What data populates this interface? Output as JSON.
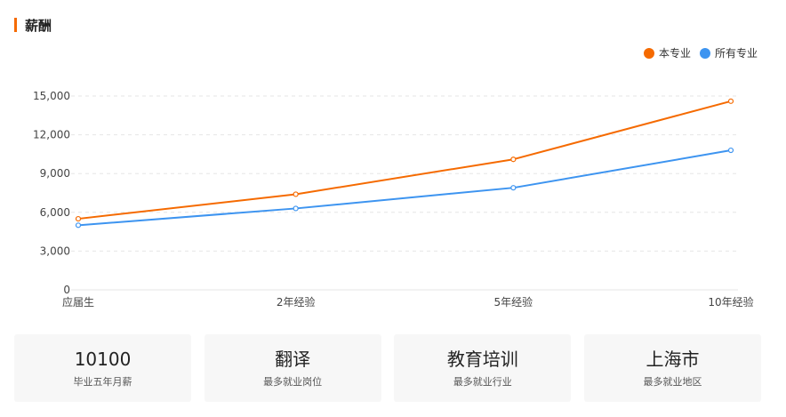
{
  "section": {
    "title": "薪酬",
    "accent_color": "#f56a00"
  },
  "chart_data": {
    "type": "line",
    "categories": [
      "应届生",
      "2年经验",
      "5年经验",
      "10年经验"
    ],
    "series": [
      {
        "name": "本专业",
        "color": "#f56a00",
        "values": [
          5500,
          7400,
          10100,
          14600
        ]
      },
      {
        "name": "所有专业",
        "color": "#3d94f0",
        "values": [
          5000,
          6300,
          7900,
          10800
        ]
      }
    ],
    "ylim": [
      0,
      15000
    ],
    "yticks": [
      0,
      3000,
      6000,
      9000,
      12000,
      15000
    ],
    "ytick_labels": [
      "0",
      "3,000",
      "6,000",
      "9,000",
      "12,000",
      "15,000"
    ],
    "grid": true,
    "legend_position": "top-right"
  },
  "cards": [
    {
      "value": "10100",
      "label": "毕业五年月薪"
    },
    {
      "value": "翻译",
      "label": "最多就业岗位"
    },
    {
      "value": "教育培训",
      "label": "最多就业行业"
    },
    {
      "value": "上海市",
      "label": "最多就业地区"
    }
  ]
}
